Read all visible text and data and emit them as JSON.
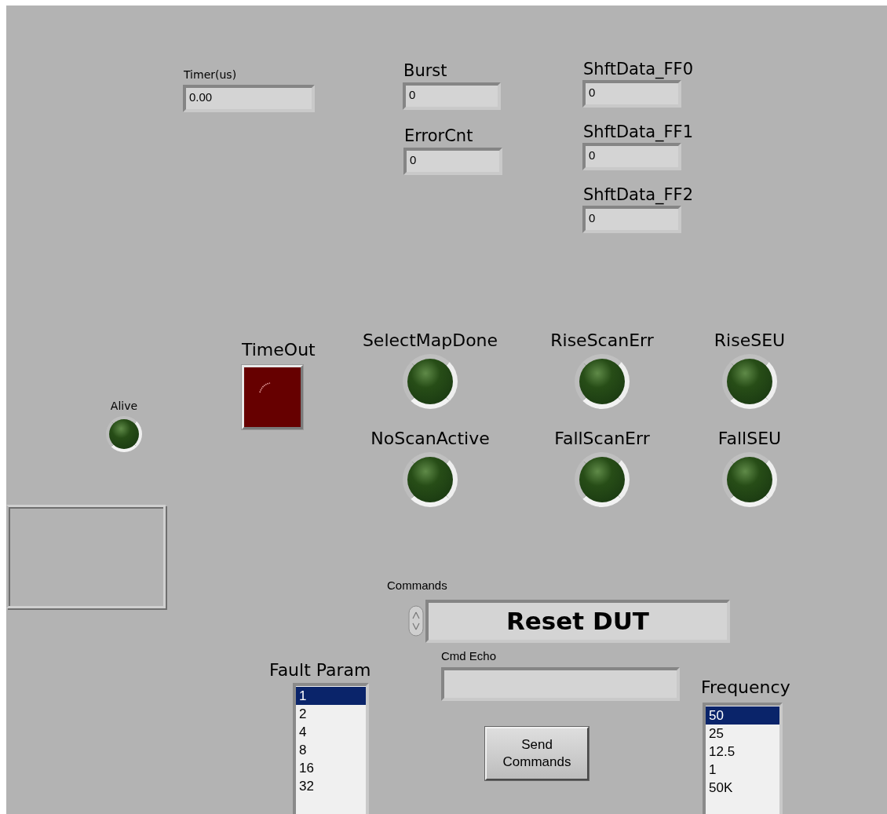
{
  "numerics": [
    {
      "label": "Timer(us)",
      "value": "0.00"
    },
    {
      "label": "Burst",
      "value": "0"
    },
    {
      "label": "ErrorCnt",
      "value": "0"
    },
    {
      "label": "ShftData_FF0",
      "value": "0"
    },
    {
      "label": "ShftData_FF1",
      "value": "0"
    },
    {
      "label": "ShftData_FF2",
      "value": "0"
    }
  ],
  "timeout": {
    "label": "TimeOut",
    "on": false
  },
  "leds": [
    {
      "label": "Alive",
      "on": false
    },
    {
      "label": "SelectMapDone",
      "on": false
    },
    {
      "label": "RiseScanErr",
      "on": false
    },
    {
      "label": "RiseSEU",
      "on": false
    },
    {
      "label": "NoScanActive",
      "on": false
    },
    {
      "label": "FallScanErr",
      "on": false
    },
    {
      "label": "FallSEU",
      "on": false
    }
  ],
  "commands": {
    "label": "Commands",
    "value": "Reset DUT"
  },
  "cmd_echo": {
    "label": "Cmd Echo"
  },
  "fault_param": {
    "label": "Fault Param",
    "items": [
      {
        "text": "1",
        "selected": true
      },
      {
        "text": "2",
        "selected": false
      },
      {
        "text": "4",
        "selected": false
      },
      {
        "text": "8",
        "selected": false
      },
      {
        "text": "16",
        "selected": false
      },
      {
        "text": "32",
        "selected": false
      }
    ]
  },
  "send_button": {
    "label": "Send Commands"
  },
  "frequency": {
    "label": "Frequency",
    "items": [
      {
        "text": "50",
        "selected": true
      },
      {
        "text": "25",
        "selected": false
      },
      {
        "text": "12.5",
        "selected": false
      },
      {
        "text": "1",
        "selected": false
      },
      {
        "text": "50K",
        "selected": false
      }
    ]
  }
}
